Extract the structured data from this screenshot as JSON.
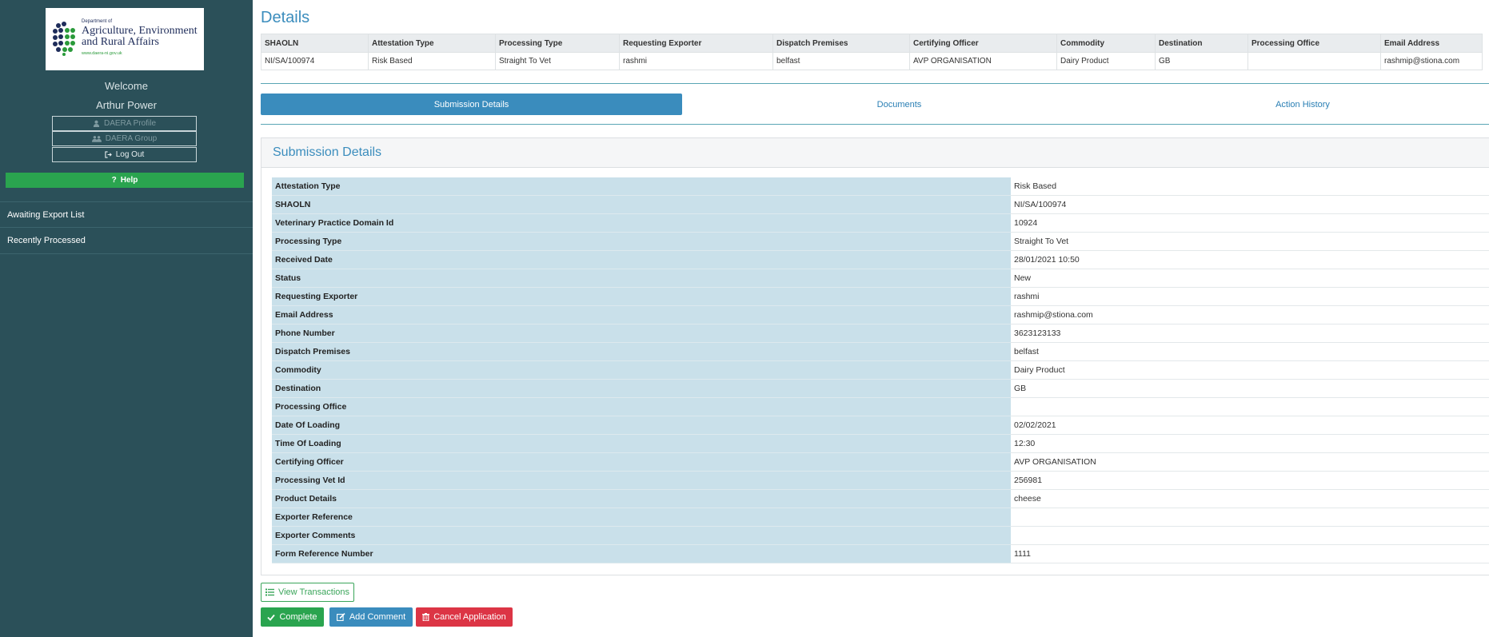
{
  "sidebar": {
    "logo": {
      "small_text": "Department of",
      "line1": "Agriculture, Environment",
      "line2": "and Rural Affairs",
      "url": "www.daera-ni.gov.uk"
    },
    "welcome": "Welcome",
    "user_name": "Arthur Power",
    "buttons": {
      "profile": "DAERA Profile",
      "group": "DAERA Group",
      "logout": "Log Out"
    },
    "help": "Help",
    "nav": [
      "Awaiting Export List",
      "Recently Processed"
    ]
  },
  "main": {
    "title": "Details",
    "summary": {
      "headers": [
        "SHAOLN",
        "Attestation Type",
        "Processing Type",
        "Requesting Exporter",
        "Dispatch Premises",
        "Certifying Officer",
        "Commodity",
        "Destination",
        "Processing Office",
        "Email Address"
      ],
      "row": [
        "NI/SA/100974",
        "Risk Based",
        "Straight To Vet",
        "rashmi",
        "belfast",
        "AVP ORGANISATION",
        "Dairy Product",
        "GB",
        "",
        "rashmip@stiona.com"
      ]
    },
    "tabs": [
      "Submission Details",
      "Documents",
      "Action History"
    ],
    "panel_title": "Submission Details",
    "details": [
      {
        "label": "Attestation Type",
        "value": "Risk Based"
      },
      {
        "label": "SHAOLN",
        "value": "NI/SA/100974"
      },
      {
        "label": "Veterinary Practice Domain Id",
        "value": "10924"
      },
      {
        "label": "Processing Type",
        "value": "Straight To Vet"
      },
      {
        "label": "Received Date",
        "value": "28/01/2021 10:50"
      },
      {
        "label": "Status",
        "value": "New"
      },
      {
        "label": "Requesting Exporter",
        "value": "rashmi"
      },
      {
        "label": "Email Address",
        "value": "rashmip@stiona.com"
      },
      {
        "label": "Phone Number",
        "value": "3623123133"
      },
      {
        "label": "Dispatch Premises",
        "value": "belfast"
      },
      {
        "label": "Commodity",
        "value": "Dairy Product"
      },
      {
        "label": "Destination",
        "value": "GB"
      },
      {
        "label": "Processing Office",
        "value": ""
      },
      {
        "label": "Date Of Loading",
        "value": "02/02/2021"
      },
      {
        "label": "Time Of Loading",
        "value": "12:30"
      },
      {
        "label": "Certifying Officer",
        "value": "AVP ORGANISATION"
      },
      {
        "label": "Processing Vet Id",
        "value": "256981"
      },
      {
        "label": "Product Details",
        "value": "cheese"
      },
      {
        "label": "Exporter Reference",
        "value": ""
      },
      {
        "label": "Exporter Comments",
        "value": ""
      },
      {
        "label": "Form Reference Number",
        "value": "1111"
      }
    ],
    "actions": {
      "view_transactions": "View Transactions",
      "complete": "Complete",
      "add_comment": "Add Comment",
      "cancel_application": "Cancel Application"
    }
  },
  "colors": {
    "sidebar_bg": "#2b5059",
    "accent_blue": "#3a8cbd",
    "success_green": "#2aa44f",
    "danger_red": "#dc3545",
    "label_bg": "#c9e0ea"
  },
  "icons": [
    "user-icon",
    "users-icon",
    "logout-icon",
    "question-icon",
    "list-icon",
    "check-icon",
    "edit-icon",
    "trash-icon"
  ]
}
